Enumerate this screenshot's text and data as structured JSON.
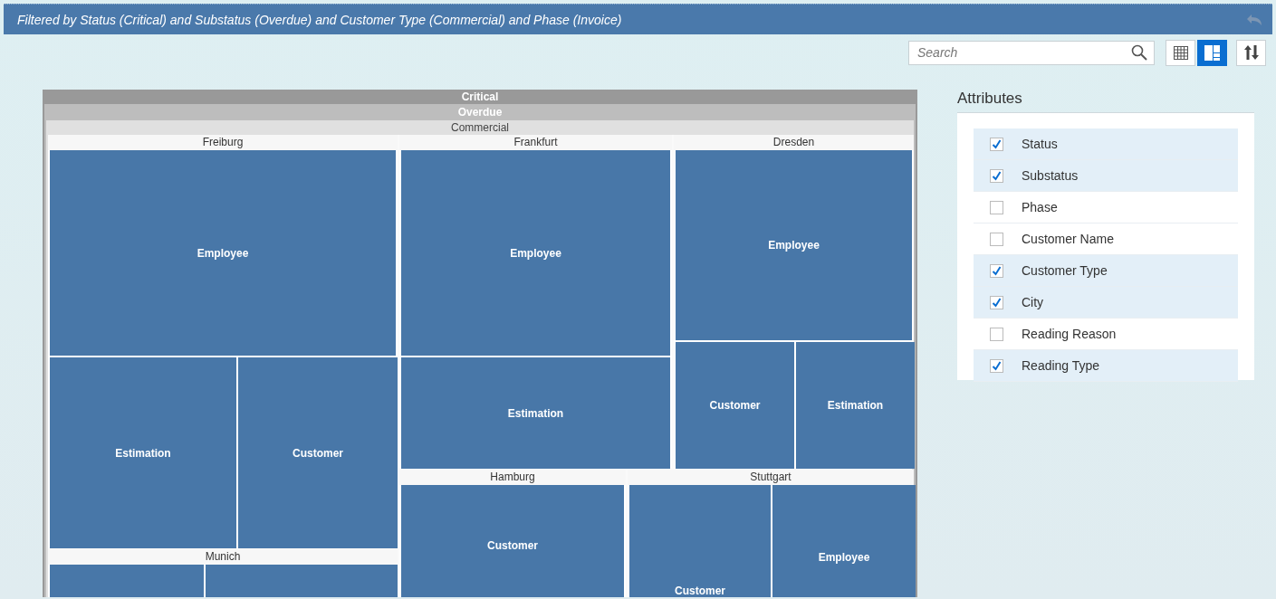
{
  "filter_bar": {
    "text": "Filtered by Status (Critical) and Substatus (Overdue) and Customer Type (Commercial) and Phase (Invoice)"
  },
  "search": {
    "placeholder": "Search"
  },
  "view_buttons": [
    {
      "kind": "table",
      "selected": false
    },
    {
      "kind": "treemap",
      "selected": true
    },
    {
      "kind": "sort",
      "selected": false
    }
  ],
  "treemap": {
    "levels": [
      "Critical",
      "Overdue",
      "Commercial"
    ],
    "cities": [
      {
        "name": "Freiburg",
        "tiles": [
          "Employee",
          "Estimation",
          "Customer"
        ]
      },
      {
        "name": "Munich"
      },
      {
        "name": "Frankfurt",
        "tiles": [
          "Employee",
          "Estimation"
        ]
      },
      {
        "name": "Dresden",
        "tiles": [
          "Employee",
          "Customer",
          "Estimation"
        ]
      },
      {
        "name": "Hamburg",
        "tiles": [
          "Customer"
        ]
      },
      {
        "name": "Stuttgart",
        "tiles": [
          "Customer",
          "Employee"
        ]
      }
    ]
  },
  "attributes": {
    "title": "Attributes",
    "items": [
      {
        "label": "Status",
        "checked": true
      },
      {
        "label": "Substatus",
        "checked": true
      },
      {
        "label": "Phase",
        "checked": false
      },
      {
        "label": "Customer Name",
        "checked": false
      },
      {
        "label": "Customer Type",
        "checked": true
      },
      {
        "label": "City",
        "checked": true
      },
      {
        "label": "Reading Reason",
        "checked": false
      },
      {
        "label": "Reading Type",
        "checked": true
      }
    ]
  }
}
